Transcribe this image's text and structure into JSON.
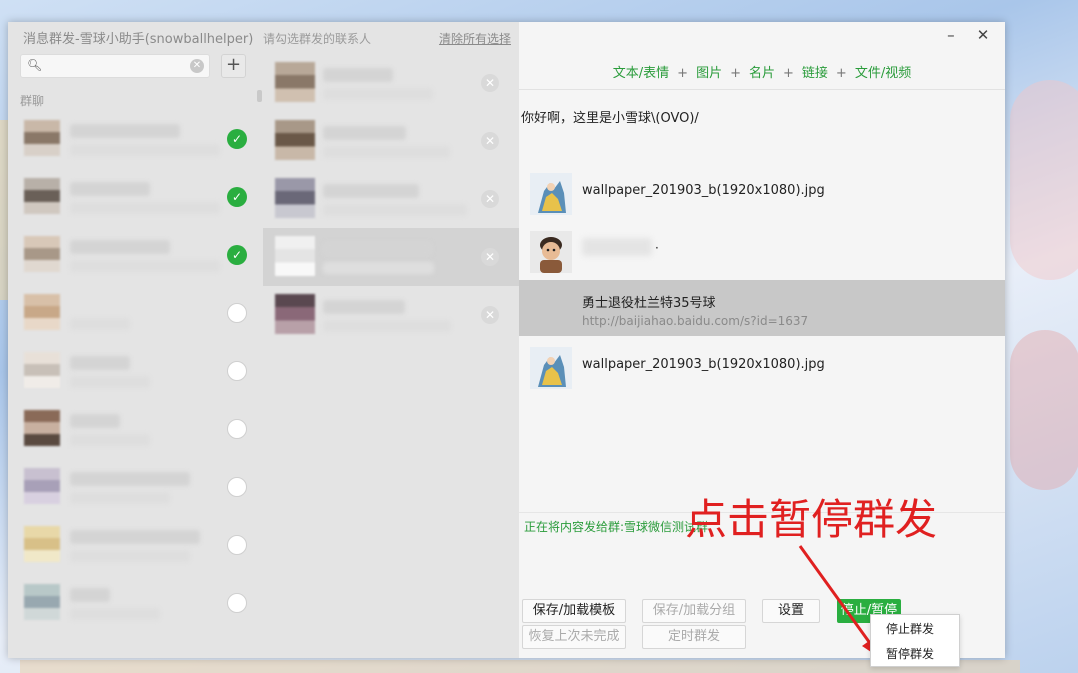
{
  "window": {
    "title": "消息群发-雪球小助手(snowballhelper)",
    "minimize": "–",
    "close": "✕"
  },
  "left": {
    "search": {
      "placeholder": "",
      "value": ""
    },
    "add_button": "+",
    "section_label": "群聊",
    "groups": [
      {
        "checked": true
      },
      {
        "checked": true
      },
      {
        "checked": true
      },
      {
        "checked": false
      },
      {
        "checked": false
      },
      {
        "checked": false
      },
      {
        "checked": false
      },
      {
        "checked": false
      },
      {
        "checked": false
      }
    ]
  },
  "middle": {
    "hint": "请勾选群发的联系人",
    "clear_all": "清除所有选择",
    "selected_count": 5,
    "highlighted_index": 3
  },
  "right": {
    "toolbar": {
      "items": [
        "文本/表情",
        "图片",
        "名片",
        "链接",
        "文件/视频"
      ],
      "separator": "+"
    },
    "message_text": "你好啊，这里是小雪球\\(OVO)/",
    "attachments": {
      "image1": "wallpaper_201903_b(1920x1080).jpg",
      "card_dot": "·",
      "link_title": "勇士退役杜兰特35号球",
      "link_url": "http://baijiahao.baidu.com/s?id=1637",
      "image2": "wallpaper_201903_b(1920x1080).jpg"
    },
    "status_text": "正在将内容发给群:雪球微信测试群",
    "buttons": {
      "save_template": "保存/加载模板",
      "save_group": "保存/加载分组",
      "settings": "设置",
      "stop_pause": "停止/暂停",
      "resume": "恢复上次未完成",
      "timed": "定时群发"
    },
    "menu": {
      "stop": "停止群发",
      "pause": "暂停群发"
    }
  },
  "annotation": {
    "text": "点击暂停群发",
    "color": "#e02020"
  },
  "colors": {
    "accent_green": "#2aae40",
    "link_green": "#2a9c3b"
  }
}
